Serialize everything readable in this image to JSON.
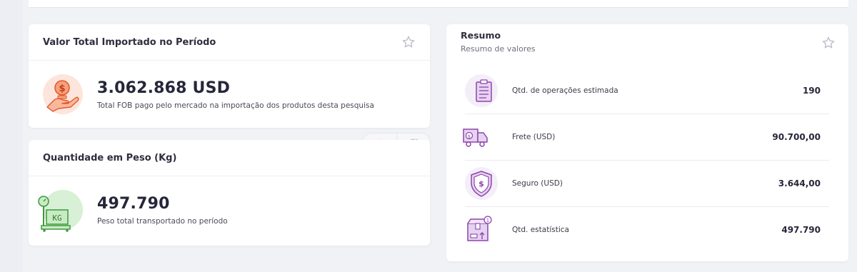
{
  "valor_card": {
    "title": "Valor Total Importado no Período",
    "value": "3.062.868 USD",
    "description": "Total FOB pago pelo mercado na importação dos produtos desta pesquisa"
  },
  "peso_card": {
    "title": "Quantidade em Peso (Kg)",
    "value": "497.790",
    "description": "Peso total transportado no período",
    "scale_label": "KG"
  },
  "resumo": {
    "title": "Resumo",
    "subtitle": "Resumo de valores",
    "rows": [
      {
        "label": "Qtd. de operações estimada",
        "value": "190",
        "icon": "clipboard-icon"
      },
      {
        "label": "Frete (USD)",
        "value": "90.700,00",
        "icon": "truck-icon"
      },
      {
        "label": "Seguro (USD)",
        "value": "3.644,00",
        "icon": "shield-dollar-icon"
      },
      {
        "label": "Qtd. estatística",
        "value": "497.790",
        "icon": "box-icon"
      }
    ]
  },
  "colors": {
    "accent_orange": "#f4774b",
    "accent_green": "#4caf50",
    "accent_purple": "#8e44ad"
  }
}
